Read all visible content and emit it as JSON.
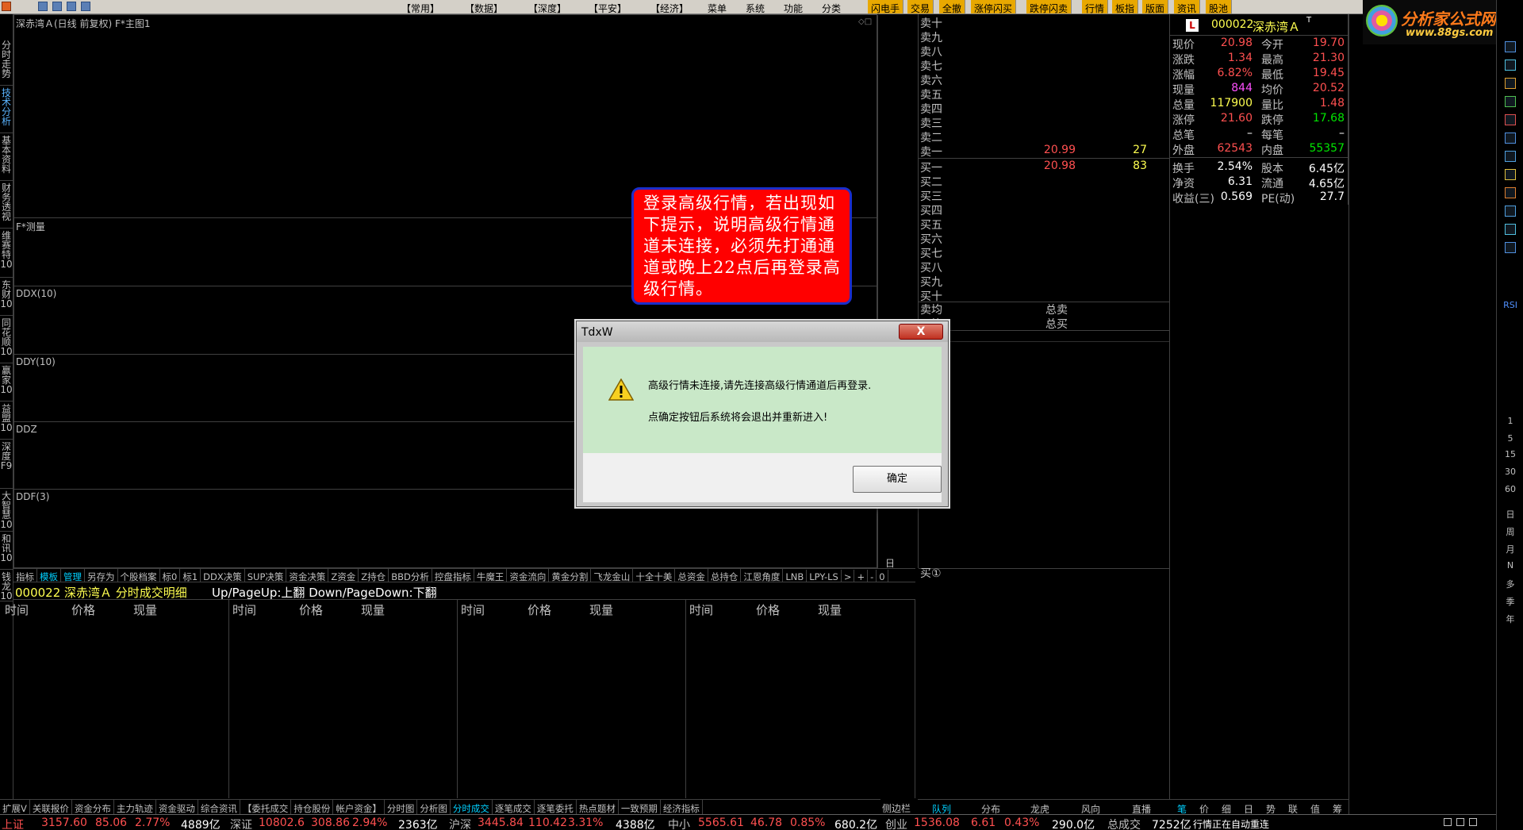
{
  "topbar": {
    "menu_items": [
      "【常用】",
      "【数据】",
      "【深度】",
      "【平安】",
      "【经济】",
      "菜单",
      "系统",
      "功能",
      "分类"
    ],
    "highlight_items": [
      "闪电手",
      "交易",
      "全撤",
      "涨停闪买",
      "跌停闪卖",
      "行情",
      "板指",
      "版面",
      "资讯",
      "股池"
    ]
  },
  "logo": {
    "title": "分析家公式网",
    "url_text": "www.88gs.com"
  },
  "left_tabs": [
    "分时走势",
    "技术分析",
    "基本资料",
    "财务透视",
    "维赛特10",
    "东财10",
    "同花顺10",
    "赢家10",
    "益盟10",
    "深度F9",
    "大智慧10",
    "和讯10",
    "钱龙10"
  ],
  "chart": {
    "main_title": "深赤湾Ａ(日线 前复权) F*主图1",
    "panels": [
      "F*测量",
      "DDX(10)",
      "DDY(10)",
      "DDZ",
      "DDF(3)"
    ],
    "period_label": "日线"
  },
  "indicator_toolbar": [
    "指标",
    "模板",
    "管理",
    "另存为",
    "个股档案",
    "标0",
    "标1",
    "DDX决策",
    "SUP决策",
    "资金决策",
    "Z资金",
    "Z持仓",
    "BBD分析",
    "控盘指标",
    "牛魔王",
    "资金流向",
    "黄金分割",
    "飞龙金山",
    "十全十美",
    "总资金",
    "总持仓",
    "江恩角度",
    "LNB",
    "LPY-LS",
    ">",
    "+",
    "-",
    "0"
  ],
  "ticks": {
    "title": "000022 深赤湾Ａ 分时成交明细",
    "hint": "Up/PageUp:上翻 Down/PageDown:下翻",
    "columns": [
      "时间",
      "价格",
      "现量"
    ]
  },
  "orderbook": {
    "sell_labels": [
      "卖十",
      "卖九",
      "卖八",
      "卖七",
      "卖六",
      "卖五",
      "卖四",
      "卖三",
      "卖二",
      "卖一"
    ],
    "buy_labels": [
      "买一",
      "买二",
      "买三",
      "买四",
      "买五",
      "买六",
      "买七",
      "买八",
      "买九",
      "买十"
    ],
    "sell1_price": "20.99",
    "sell1_vol": "27",
    "buy1_price": "20.98",
    "buy1_vol": "83",
    "avg_sell_label": "卖均",
    "avg_buy_label": "买均",
    "total_sell_label": "总卖",
    "total_buy_label": "总买",
    "buy_queue_label": "买①",
    "side_label": "侧边栏>"
  },
  "quote": {
    "code": "000022",
    "name": "深赤湾Ａ",
    "badge": "L",
    "mark": "T",
    "rows": [
      {
        "l1": "现价",
        "v1": "20.98",
        "c1": "red",
        "l2": "今开",
        "v2": "19.70",
        "c2": "red"
      },
      {
        "l1": "涨跌",
        "v1": "1.34",
        "c1": "red",
        "l2": "最高",
        "v2": "21.30",
        "c2": "red"
      },
      {
        "l1": "涨幅",
        "v1": "6.82%",
        "c1": "red",
        "l2": "最低",
        "v2": "19.45",
        "c2": "red"
      },
      {
        "l1": "现量",
        "v1": "844",
        "c1": "mag",
        "l2": "均价",
        "v2": "20.52",
        "c2": "red"
      },
      {
        "l1": "总量",
        "v1": "117900",
        "c1": "yel",
        "l2": "量比",
        "v2": "1.48",
        "c2": "red"
      },
      {
        "l1": "涨停",
        "v1": "21.60",
        "c1": "red",
        "l2": "跌停",
        "v2": "17.68",
        "c2": "green"
      },
      {
        "l1": "总笔",
        "v1": "–",
        "c1": "white",
        "l2": "每笔",
        "v2": "–",
        "c2": "white"
      },
      {
        "l1": "外盘",
        "v1": "62543",
        "c1": "red",
        "l2": "内盘",
        "v2": "55357",
        "c2": "green"
      },
      {
        "l1": "换手",
        "v1": "2.54%",
        "c1": "white",
        "l2": "股本",
        "v2": "6.45亿",
        "c2": "white"
      },
      {
        "l1": "净资",
        "v1": "6.31",
        "c1": "white",
        "l2": "流通",
        "v2": "4.65亿",
        "c2": "white"
      },
      {
        "l1": "收益(三)",
        "v1": "0.569",
        "c1": "white",
        "l2": "PE(动)",
        "v2": "27.7",
        "c2": "white"
      }
    ]
  },
  "right_tabs": [
    "队列",
    "分布",
    "龙虎",
    "风向",
    "直播"
  ],
  "right_mini_tabs": [
    "笔",
    "价",
    "细",
    "日",
    "势",
    "联",
    "值",
    "筹"
  ],
  "right_strip_labels": [
    "RSI",
    "1",
    "5",
    "15",
    "30",
    "60",
    "日",
    "周",
    "月",
    "N",
    "多",
    "季",
    "年"
  ],
  "callout_text": "登录高级行情，若出现如下提示，说明高级行情通道未连接，必须先打通通道或晚上22点后再登录高级行情。",
  "dialog": {
    "title": "TdxW",
    "close": "X",
    "line1": "高级行情未连接,请先连接高级行情通道后再登录.",
    "line2": "点确定按钮后系统将会退出并重新进入!",
    "ok": "确定"
  },
  "bottom_toolbar": [
    "扩展V",
    "关联报价",
    "资金分布",
    "主力轨迹",
    "资金驱动",
    "综合资讯",
    "【委托成交",
    "持仓股份",
    "帐户资金】",
    "分时图",
    "分析图",
    "分时成交",
    "逐笔成交",
    "逐笔委托",
    "热点题材",
    "一致预期",
    "经济指标"
  ],
  "status": {
    "sh_label": "上证",
    "sh_val": "3157.60",
    "sh_chg": "85.06",
    "sh_pct": "2.77%",
    "sh_amt": "4889亿",
    "sz_label": "深证",
    "sz_val": "10802.6",
    "sz_chg": "308.86",
    "sz_pct": "2.94%",
    "sz_amt": "2363亿",
    "hs_label": "沪深",
    "hs_val": "3445.84",
    "hs_chg": "110.42",
    "hs_pct": "3.31%",
    "hs_amt": "4388亿",
    "zx_label": "中小",
    "zx_val": "5565.61",
    "zx_chg": "46.78",
    "zx_pct": "0.85%",
    "zx_amt": "680.2亿",
    "cy_label": "创业",
    "cy_val": "1536.08",
    "cy_chg": "6.61",
    "cy_pct": "0.43%",
    "cy_amt": "290.0亿",
    "total_label": "总成交",
    "total_amt": "7252亿",
    "msg": "行情正在自动重连"
  }
}
